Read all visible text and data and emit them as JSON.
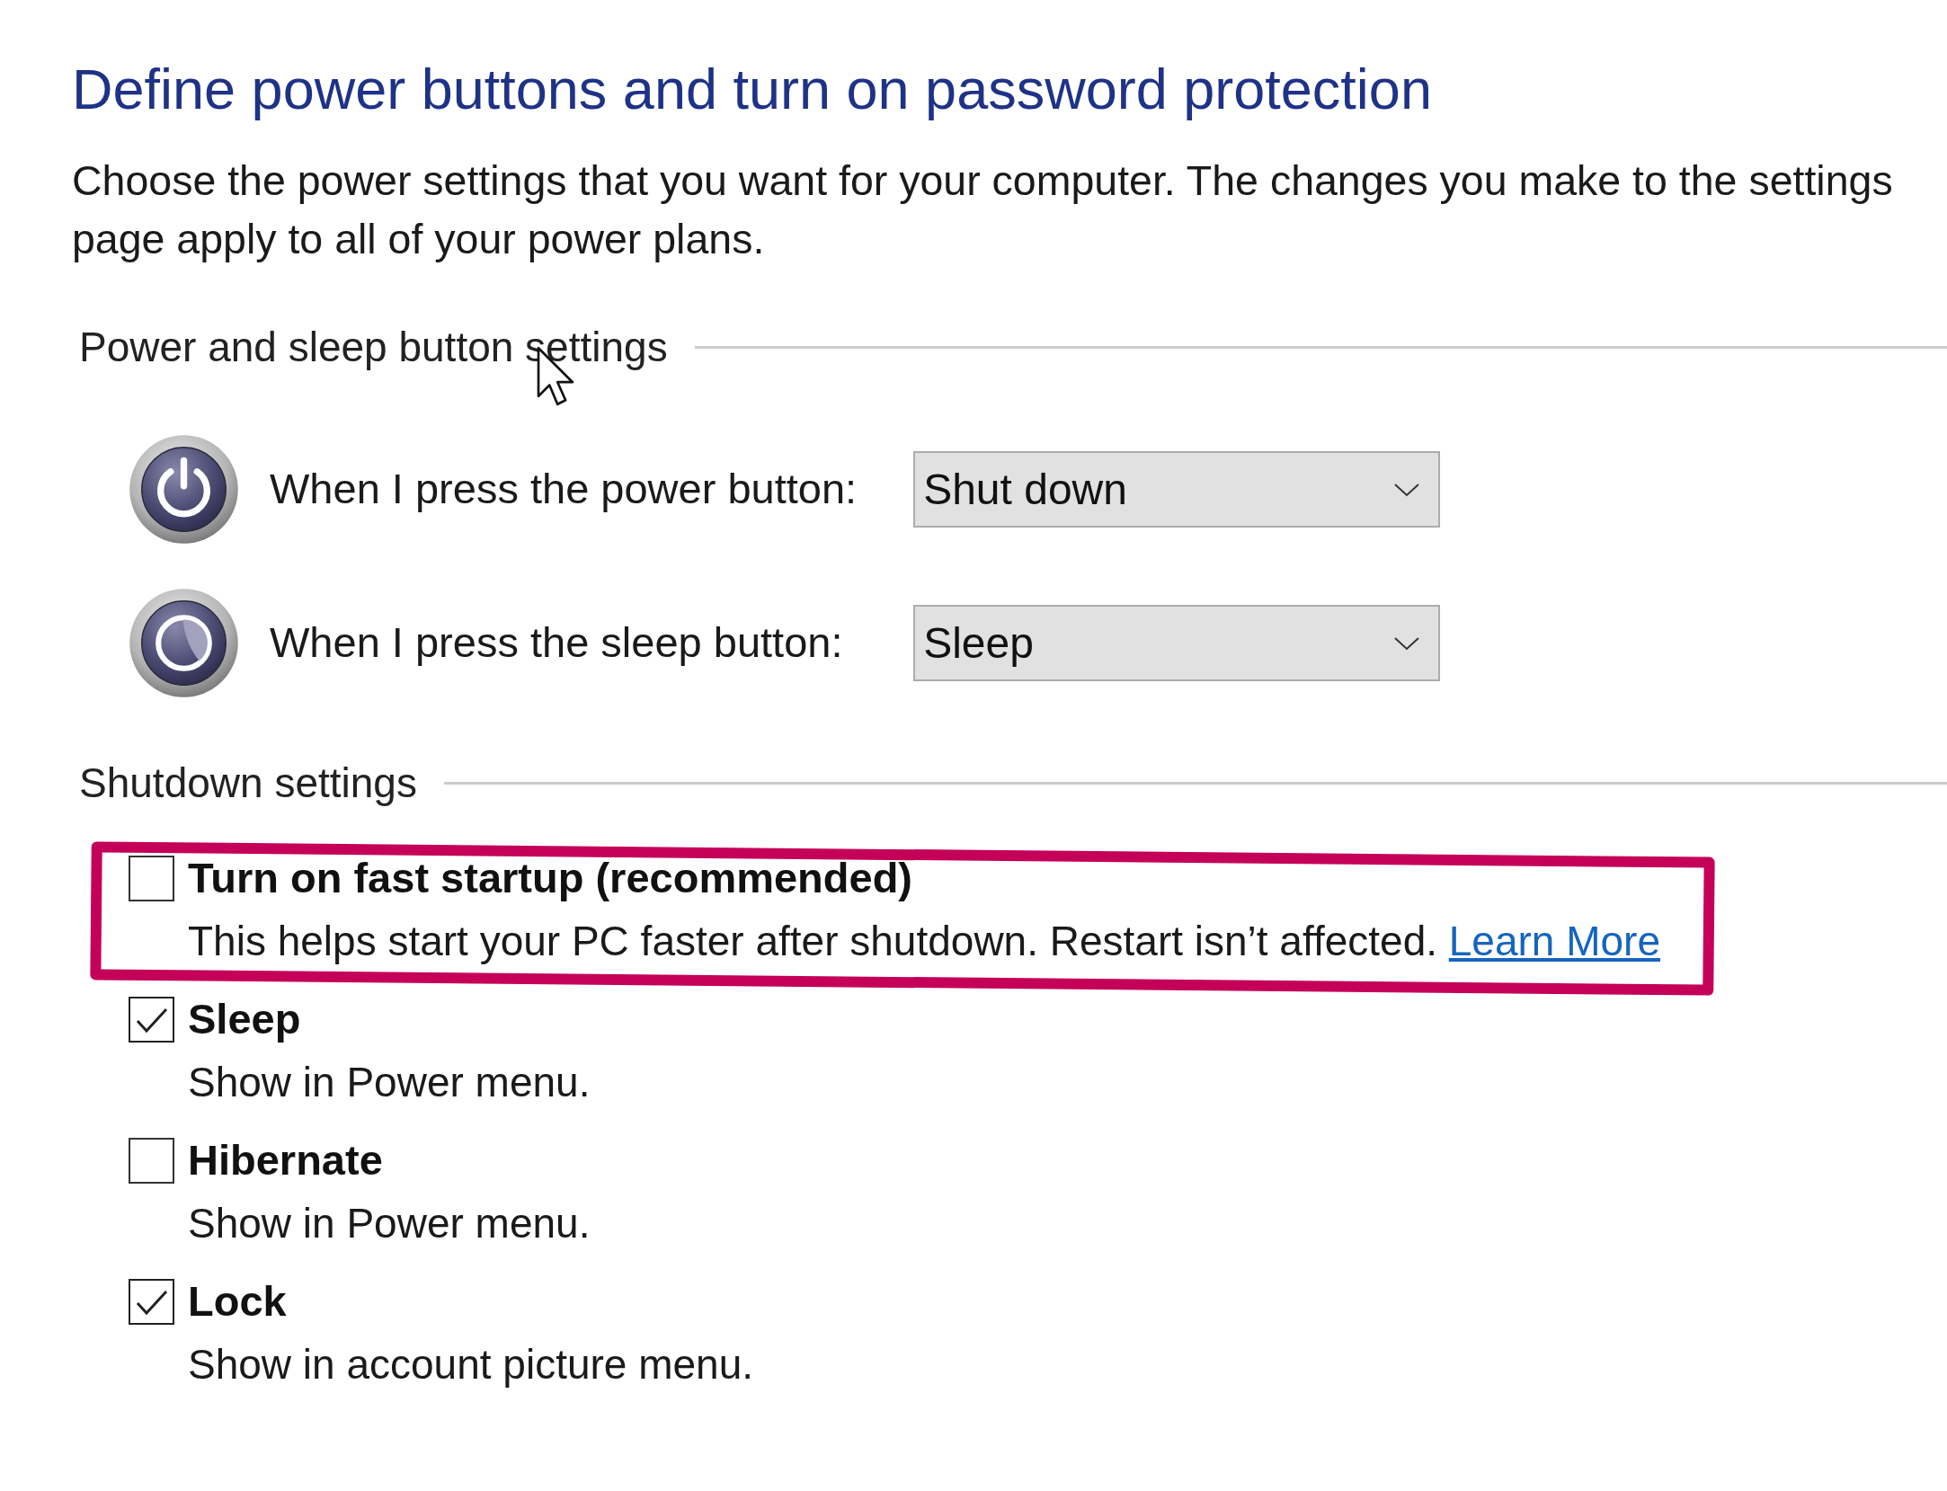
{
  "page": {
    "title": "Define power buttons and turn on password protection",
    "description_lines": [
      "Choose the power settings that you want for your computer. The changes you make to the settings",
      "page apply to all of your power plans."
    ]
  },
  "power_sleep_section": {
    "heading": "Power and sleep button settings",
    "rows": [
      {
        "kind": "power",
        "label": "When I press the power button:",
        "value": "Shut down"
      },
      {
        "kind": "sleep",
        "label": "When I press the sleep button:",
        "value": "Sleep"
      }
    ]
  },
  "shutdown_section": {
    "heading": "Shutdown settings",
    "options": [
      {
        "title": "Turn on fast startup (recommended)",
        "description": "This helps start your PC faster after shutdown. Restart isn’t affected.",
        "link": "Learn More",
        "checked": false,
        "highlighted": true
      },
      {
        "title": "Sleep",
        "description": "Show in Power menu.",
        "checked": true,
        "highlighted": false
      },
      {
        "title": "Hibernate",
        "description": "Show in Power menu.",
        "checked": false,
        "highlighted": false
      },
      {
        "title": "Lock",
        "description": "Show in account picture menu.",
        "checked": true,
        "highlighted": false
      }
    ]
  }
}
